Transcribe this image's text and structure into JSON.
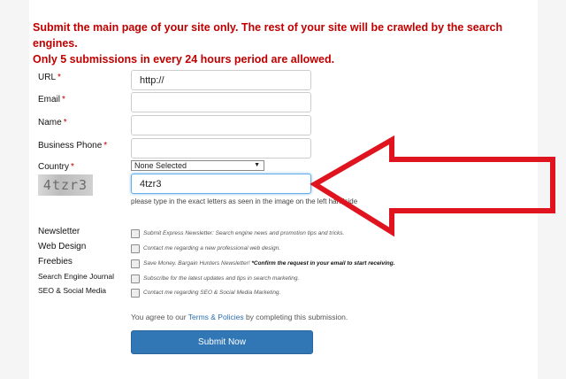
{
  "notice": {
    "line1": "Submit the main page of your site only. The rest of your site will be crawled by the search engines.",
    "line2": "Only 5 submissions in every 24 hours period are allowed."
  },
  "fields": {
    "url": {
      "label": "URL",
      "value": "http://"
    },
    "email": {
      "label": "Email",
      "value": ""
    },
    "name": {
      "label": "Name",
      "value": ""
    },
    "phone": {
      "label": "Business Phone",
      "value": ""
    },
    "country": {
      "label": "Country",
      "selected": "None Selected"
    },
    "captcha": {
      "image_text": "4tzr3",
      "value": "4tzr3",
      "hint": "please type in the exact letters as seen in the image on the left handside"
    }
  },
  "required_marker": "*",
  "options": [
    {
      "label": "Newsletter",
      "text": "Submit Express Newsletter: Search engine news and promotion tips and tricks.",
      "bold": ""
    },
    {
      "label": "Web Design",
      "text": "Contact me regarding a new professional web design.",
      "bold": ""
    },
    {
      "label": "Freebies",
      "text": "Save Money. Bargain Hunters Newsletter! ",
      "bold": "*Confirm the request in your email to start receiving."
    },
    {
      "label": "Search Engine Journal",
      "text": "Subscribe for the latest updates and tips in search marketing.",
      "bold": ""
    },
    {
      "label": "SEO & Social Media",
      "text": "Contact me regarding SEO & Social Media Marketing.",
      "bold": ""
    }
  ],
  "agree": {
    "prefix": "You agree to our ",
    "link": "Terms & Policies",
    "suffix": " by completing this submission."
  },
  "submit_label": "Submit Now",
  "colors": {
    "notice": "#c00000",
    "button": "#3277b5",
    "arrow": "#e0141e"
  }
}
